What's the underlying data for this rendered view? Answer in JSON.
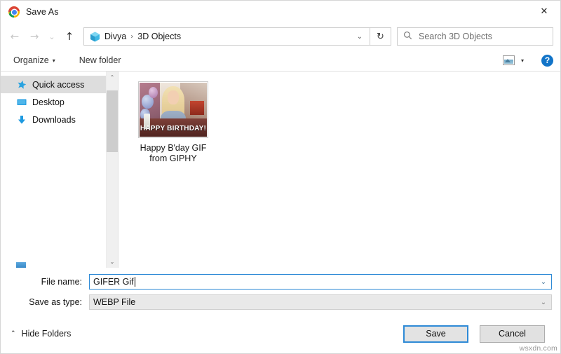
{
  "window": {
    "title": "Save As",
    "app_icon": "chrome-logo-icon",
    "close_label": "✕"
  },
  "nav": {
    "back_icon": "←",
    "forward_icon": "→",
    "recent_icon": "⌄",
    "up_icon": "↑",
    "refresh_icon": "↻",
    "address": {
      "folder_icon": "3d-objects-cube-icon",
      "separator": "›",
      "crumbs": [
        "Divya",
        "3D Objects"
      ],
      "chevron": "⌄"
    },
    "search": {
      "placeholder": "Search 3D Objects",
      "icon": "search-icon"
    }
  },
  "toolbar": {
    "organize_label": "Organize",
    "organize_caret": "▾",
    "new_folder_label": "New folder",
    "view_caret": "▾",
    "help_label": "?"
  },
  "sidebar": {
    "items": [
      {
        "label": "Quick access",
        "icon": "star-pin-icon",
        "selected": true,
        "pinned": false
      },
      {
        "label": "Desktop",
        "icon": "monitor-icon",
        "selected": false,
        "pinned": true
      },
      {
        "label": "Downloads",
        "icon": "download-arrow-icon",
        "selected": false,
        "pinned": true
      },
      {
        "label": "",
        "icon": "blank-icon",
        "selected": false,
        "pinned": true
      },
      {
        "label": "",
        "icon": "blank-icon",
        "selected": false,
        "pinned": true
      }
    ],
    "scroll_up": "⌃",
    "scroll_down": "⌄",
    "clipped_item_label": ""
  },
  "files": [
    {
      "name": "Happy B'day GIF\nfrom GIPHY",
      "thumbnail_caption": "HAPPY\nBIRTHDAY!"
    }
  ],
  "form": {
    "file_name_label": "File name:",
    "file_name_value": "GIFER Gif",
    "save_as_type_label": "Save as type:",
    "save_as_type_value": "WEBP File",
    "dropdown_icon": "⌄"
  },
  "footer": {
    "hide_folders_label": "Hide Folders",
    "hide_folders_chevron": "⌃",
    "save_label": "Save",
    "cancel_label": "Cancel"
  },
  "watermark": "wsxdn.com",
  "colors": {
    "accent": "#2e8ad6",
    "selection": "#dddddd",
    "help_blue": "#1274c8"
  }
}
